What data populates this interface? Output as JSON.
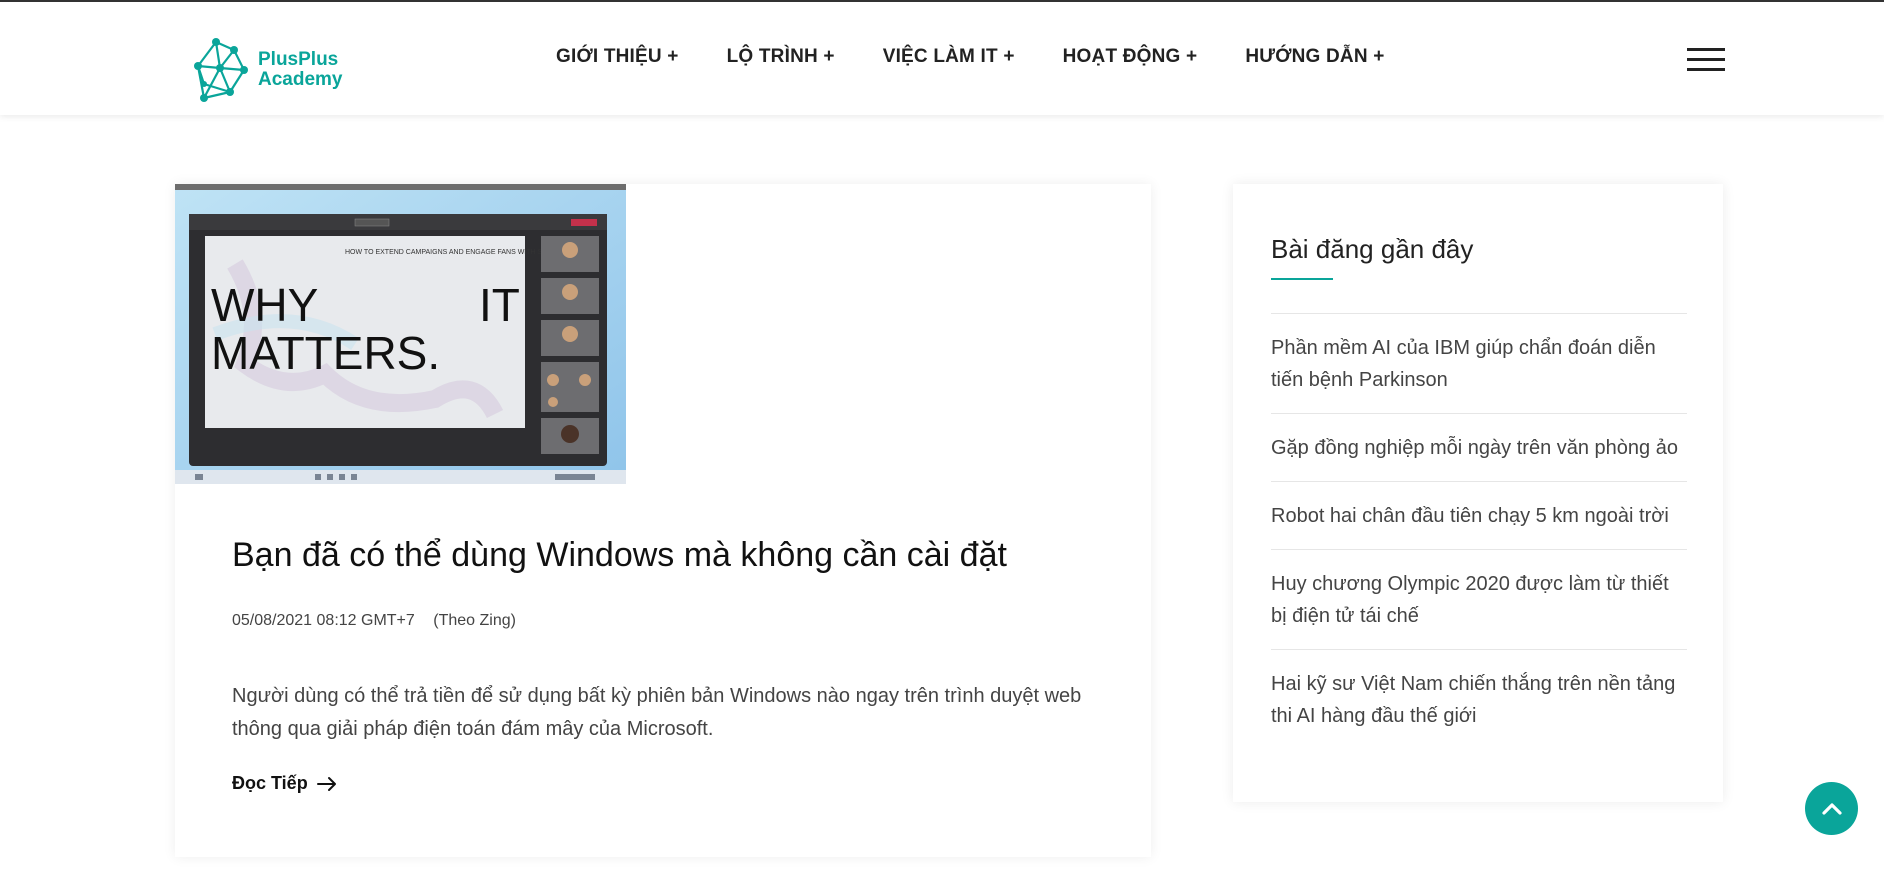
{
  "brand": {
    "line1": "PlusPlus",
    "line2": "Academy",
    "color": "#0aa59a"
  },
  "nav": [
    {
      "label": "GIỚI THIỆU +"
    },
    {
      "label": "LỘ TRÌNH +"
    },
    {
      "label": "VIỆC LÀM IT +"
    },
    {
      "label": "HOẠT ĐỘNG +"
    },
    {
      "label": "HƯỚNG DẪN +"
    }
  ],
  "menu_icon": "hamburger-icon",
  "post": {
    "image_text": {
      "line1": "WHY",
      "line1b": "IT",
      "line2": "MATTERS.",
      "banner": "HOW TO EXTEND CAMPAIGNS AND ENGAGE FANS WITH SOCIAL MEDIA."
    },
    "title": "Bạn đã có thể dùng Windows mà không cần cài đặt",
    "date": "05/08/2021 08:12 GMT+7",
    "source": "(Theo Zing)",
    "excerpt": "Người dùng có thể trả tiền để sử dụng bất kỳ phiên bản Windows nào ngay trên trình duyệt web thông qua giải pháp điện toán đám mây của Microsoft.",
    "read_more": "Đọc Tiếp",
    "read_more_icon": "arrow-right-icon"
  },
  "sidebar": {
    "title": "Bài đăng gần đây",
    "items": [
      {
        "label": "Phần mềm AI của IBM giúp chẩn đoán diễn tiến bệnh Parkinson"
      },
      {
        "label": "Gặp đồng nghiệp mỗi ngày trên văn phòng ảo"
      },
      {
        "label": "Robot hai chân đầu tiên chạy 5 km ngoài trời"
      },
      {
        "label": "Huy chương Olympic 2020 được làm từ thiết bị điện tử tái chế"
      },
      {
        "label": "Hai kỹ sư Việt Nam chiến thắng trên nền tảng thi AI hàng đầu thế giới"
      }
    ]
  },
  "scroll_top_icon": "chevron-up-icon"
}
